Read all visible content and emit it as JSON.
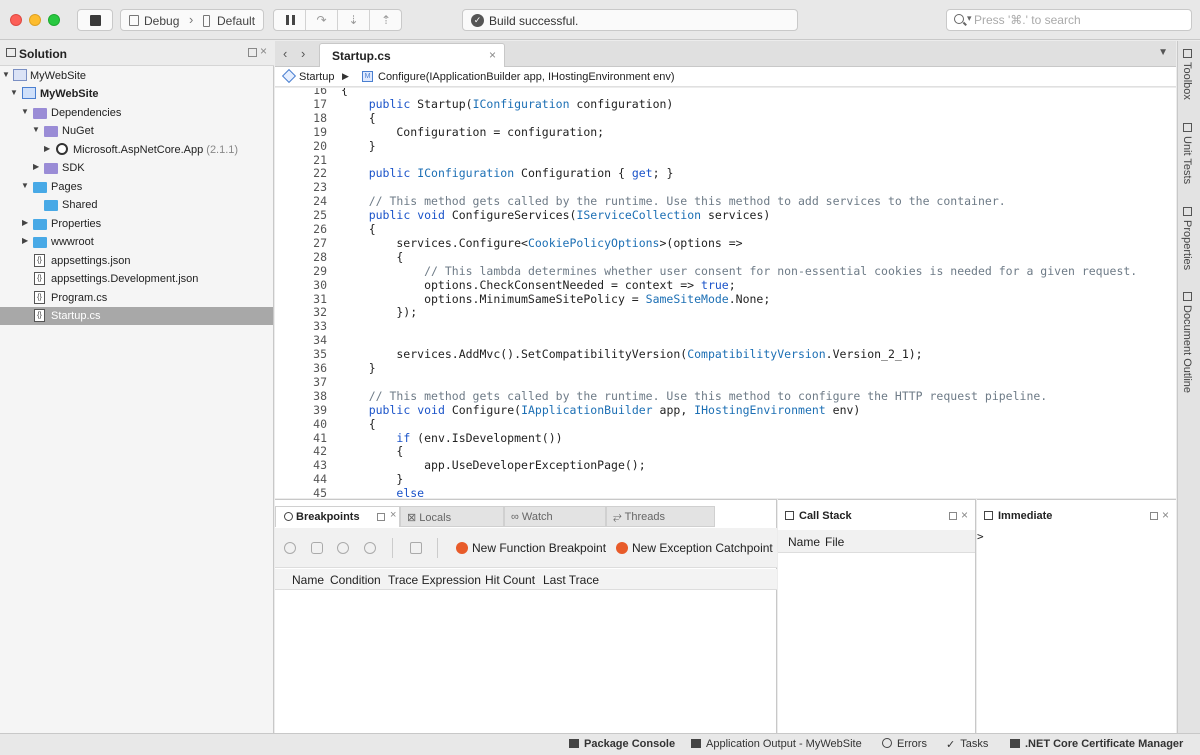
{
  "toolbar": {
    "configuration": "Debug",
    "device": "Default",
    "status": "Build successful.",
    "search_placeholder": "Press '⌘.' to search"
  },
  "solution": {
    "title": "Solution",
    "items": [
      {
        "label": "MyWebSite",
        "extra": ""
      },
      {
        "label": "MyWebSite",
        "extra": ""
      },
      {
        "label": "Dependencies",
        "extra": ""
      },
      {
        "label": "NuGet",
        "extra": ""
      },
      {
        "label": "Microsoft.AspNetCore.App",
        "extra": "(2.1.1)"
      },
      {
        "label": "SDK",
        "extra": ""
      },
      {
        "label": "Pages",
        "extra": ""
      },
      {
        "label": "Shared",
        "extra": ""
      },
      {
        "label": "Properties",
        "extra": ""
      },
      {
        "label": "wwwroot",
        "extra": ""
      },
      {
        "label": "appsettings.json",
        "extra": ""
      },
      {
        "label": "appsettings.Development.json",
        "extra": ""
      },
      {
        "label": "Program.cs",
        "extra": ""
      },
      {
        "label": "Startup.cs",
        "extra": ""
      }
    ]
  },
  "editor": {
    "tab": "Startup.cs",
    "breadcrumb": {
      "class": "Startup",
      "method": "Configure(IApplicationBuilder app, IHostingEnvironment env)"
    },
    "lines": [
      {
        "n": "16",
        "code": "{"
      },
      {
        "n": "17",
        "code": "    public Startup(IConfiguration configuration)"
      },
      {
        "n": "18",
        "code": "    {"
      },
      {
        "n": "19",
        "code": "        Configuration = configuration;"
      },
      {
        "n": "20",
        "code": "    }"
      },
      {
        "n": "21",
        "code": ""
      },
      {
        "n": "22",
        "code": "    public IConfiguration Configuration { get; }"
      },
      {
        "n": "23",
        "code": ""
      },
      {
        "n": "24",
        "code": "    // This method gets called by the runtime. Use this method to add services to the container."
      },
      {
        "n": "25",
        "code": "    public void ConfigureServices(IServiceCollection services)"
      },
      {
        "n": "26",
        "code": "    {"
      },
      {
        "n": "27",
        "code": "        services.Configure<CookiePolicyOptions>(options =>"
      },
      {
        "n": "28",
        "code": "        {"
      },
      {
        "n": "29",
        "code": "            // This lambda determines whether user consent for non-essential cookies is needed for a given request."
      },
      {
        "n": "30",
        "code": "            options.CheckConsentNeeded = context => true;"
      },
      {
        "n": "31",
        "code": "            options.MinimumSameSitePolicy = SameSiteMode.None;"
      },
      {
        "n": "32",
        "code": "        });"
      },
      {
        "n": "33",
        "code": ""
      },
      {
        "n": "34",
        "code": ""
      },
      {
        "n": "35",
        "code": "        services.AddMvc().SetCompatibilityVersion(CompatibilityVersion.Version_2_1);"
      },
      {
        "n": "36",
        "code": "    }"
      },
      {
        "n": "37",
        "code": ""
      },
      {
        "n": "38",
        "code": "    // This method gets called by the runtime. Use this method to configure the HTTP request pipeline."
      },
      {
        "n": "39",
        "code": "    public void Configure(IApplicationBuilder app, IHostingEnvironment env)"
      },
      {
        "n": "40",
        "code": "    {"
      },
      {
        "n": "41",
        "code": "        if (env.IsDevelopment())"
      },
      {
        "n": "42",
        "code": "        {"
      },
      {
        "n": "43",
        "code": "            app.UseDeveloperExceptionPage();"
      },
      {
        "n": "44",
        "code": "        }"
      },
      {
        "n": "45",
        "code": "        else"
      }
    ]
  },
  "breakpoints_pad": {
    "tabs": [
      "Breakpoints",
      "Locals",
      "Watch",
      "Threads"
    ],
    "new_function_breakpoint": "New Function Breakpoint",
    "new_exception_catchpoint": "New Exception Catchpoint",
    "columns": [
      "Name",
      "Condition",
      "Trace Expression",
      "Hit Count",
      "Last Trace"
    ]
  },
  "callstack_pad": {
    "title": "Call Stack",
    "columns": [
      "Name",
      "File"
    ]
  },
  "immediate_pad": {
    "title": "Immediate",
    "prompt": ">"
  },
  "side_pads": [
    "Toolbox",
    "Unit Tests",
    "Properties",
    "Document Outline"
  ],
  "status_bar": [
    "Package Console",
    "Application Output - MyWebSite",
    "Errors",
    "Tasks",
    ".NET Core Certificate Manager"
  ]
}
